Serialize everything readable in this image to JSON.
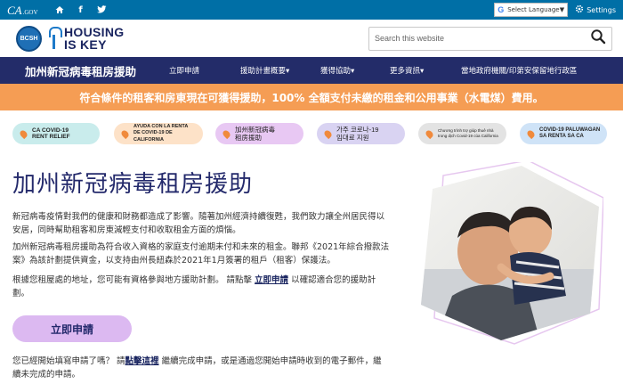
{
  "govbar": {
    "ca_logo": "CA",
    "ca_gov": ".GOV",
    "language_label": "Select Language",
    "settings_label": "Settings"
  },
  "header": {
    "seal_text": "BCSH",
    "logo_line1": "HOUSING",
    "logo_line2": "IS KEY",
    "search_placeholder": "Search this website"
  },
  "nav": {
    "brand": "加州新冠病毒租房援助",
    "items": [
      {
        "label": "立即申請"
      },
      {
        "label": "援助計畫概要▾"
      },
      {
        "label": "獲得協助▾"
      },
      {
        "label": "更多資訊▾"
      },
      {
        "label": "當地政府機關/印第安保留地行政區"
      }
    ]
  },
  "banner": {
    "text": "符合條件的租客和房東現在可獲得援助，100% 全額支付未繳的租金和公用事業（水電煤）費用。"
  },
  "pills": [
    {
      "line1": "CA COVID-19",
      "line2": "RENT RELIEF",
      "bg": "#c9ecec"
    },
    {
      "line1": "AYUDA CON LA RENTA",
      "line2": "DE COVID-19 DE CALIFORNIA",
      "bg": "#fde2c8"
    },
    {
      "line1": "加州新冠病毒",
      "line2": "租房援助",
      "bg": "#e8c8f3"
    },
    {
      "line1": "가주 코로나-19",
      "line2": "임대료 지원",
      "bg": "#d9d3f2"
    },
    {
      "line1": "Chương trình trợ giúp thuê nhà",
      "line2": "trong dịch Covid-19 của California",
      "bg": "#e3e3e3"
    },
    {
      "line1": "COVID-19 PALUWAGAN",
      "line2": "SA RENTA SA CA",
      "bg": "#cfe3f7"
    }
  ],
  "main": {
    "title": "加州新冠病毒租房援助",
    "p1_line1": "新冠病毒疫情對我們的健康和財務都造成了影響。隨著加州經濟持續復甦，我們致力讓全州居民得以",
    "p1_line2": "安居，同時幫助租客和房東減輕支付和收取租金方面的煩惱。",
    "p2_line1": "加州新冠病毒租房援助為符合收入資格的家庭支付逾期未付和未來的租金。聯邦《2021年綜合撥款法",
    "p2_line2": "案》為該計劃提供資金，以支持由州長紐森於2021年1月簽署的租戶（租客）保護法。",
    "p3_line1_a": "根據您租屋處的地址，您可能有資格參與地方援助計劃。 請點擊 ",
    "p3_link": "立即申請",
    "p3_line1_b": " 以確認適合您的援助計",
    "p3_line2": "劃。",
    "apply_label": "立即申請",
    "p4_line1_a": "您已經開始填寫申請了嗎？ 請",
    "p4_link": "點擊這裡",
    "p4_line1_b": " 繼續完成申請，或是通過您開始申請時收到的電子郵件，繼",
    "p4_line2": "續未完成的申請。"
  },
  "colors": {
    "govbar": "#006fa6",
    "nav": "#232c69",
    "banner": "#f59d54",
    "title": "#23296b",
    "apply_button": "#dcb9f1"
  }
}
